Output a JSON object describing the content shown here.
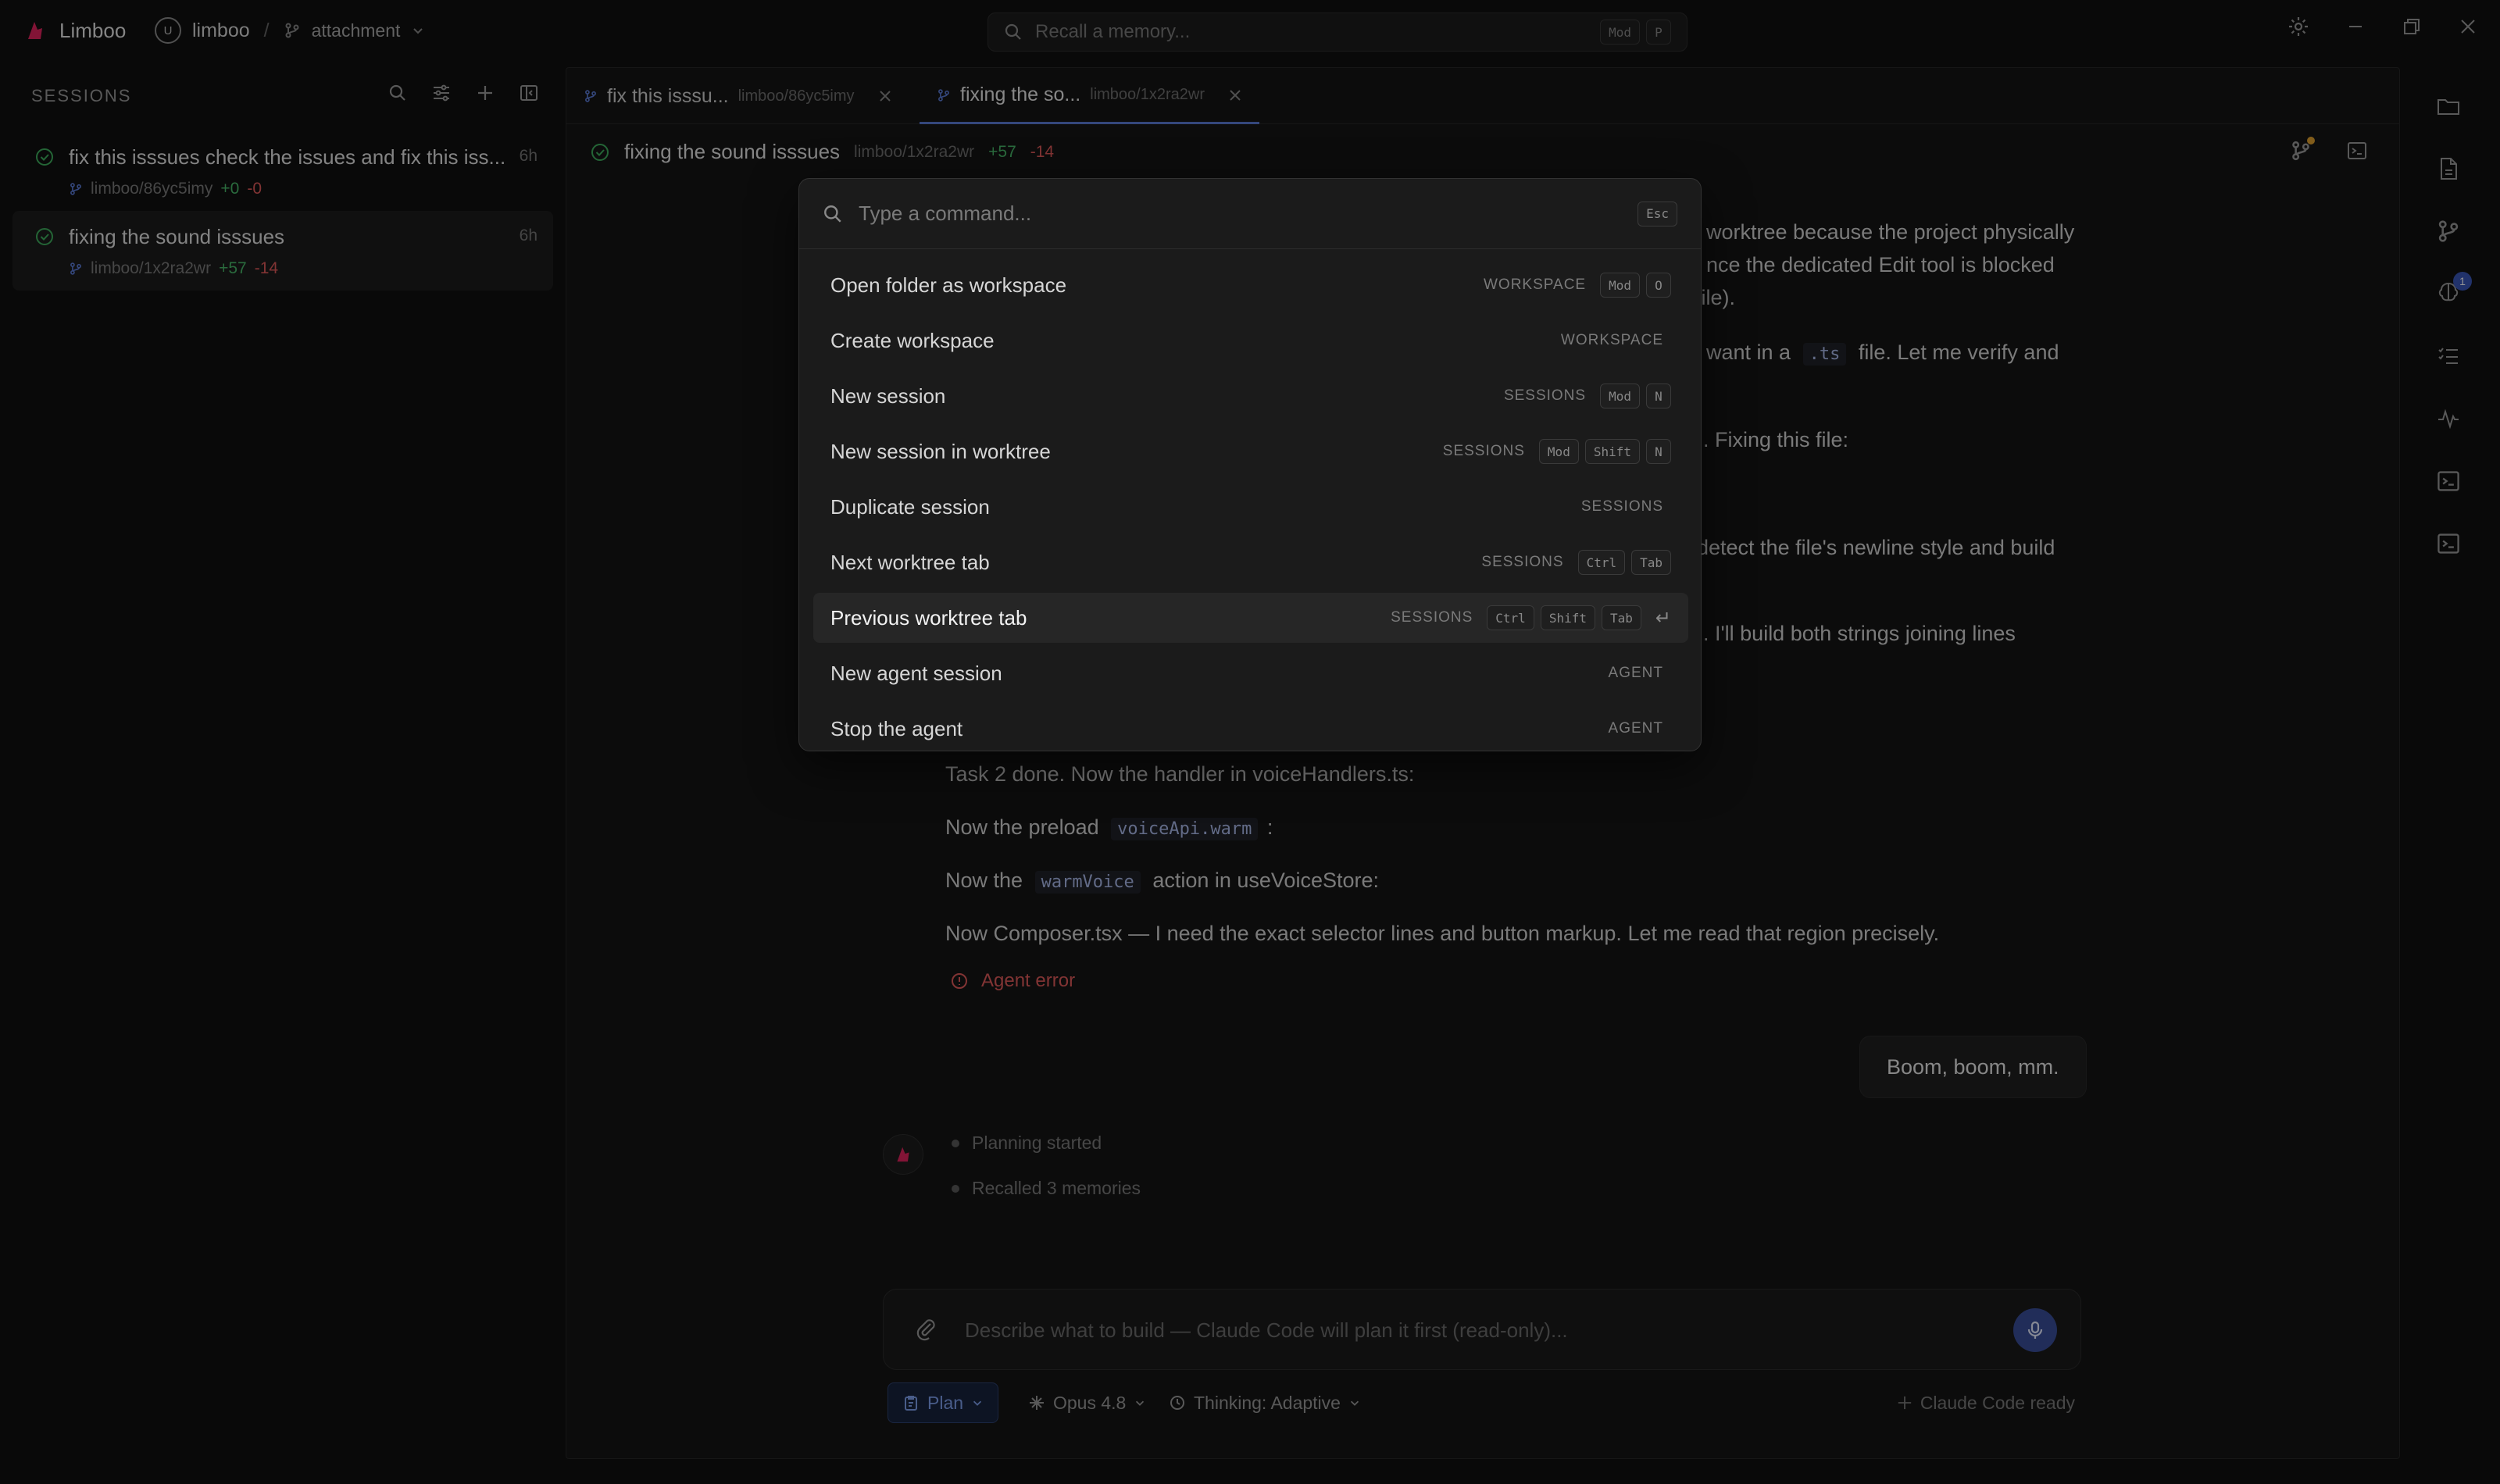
{
  "app": {
    "name": "Limboo",
    "workspace": "limboo",
    "workspace_badge": "U",
    "separator": "/",
    "branch": "attachment"
  },
  "search": {
    "placeholder": "Recall a memory...",
    "keys": [
      "Mod",
      "P"
    ]
  },
  "sidebar": {
    "title": "SESSIONS",
    "sessions": [
      {
        "title": "fix this isssues check the issues and fix this iss...",
        "time": "6h",
        "branch": "limboo/86yc5imy",
        "added": "+0",
        "removed": "-0"
      },
      {
        "title": "fixing the sound isssues",
        "time": "6h",
        "branch": "limboo/1x2ra2wr",
        "added": "+57",
        "removed": "-14"
      }
    ]
  },
  "tabs": [
    {
      "label": "fix this isssu...",
      "path": "limboo/86yc5imy"
    },
    {
      "label": "fixing the so...",
      "path": "limboo/1x2ra2wr"
    }
  ],
  "header": {
    "title": "fixing the sound isssues",
    "path": "limboo/1x2ra2wr",
    "added": "+57",
    "removed": "-14"
  },
  "chat": {
    "partial": {
      "l1": "worktree because the project physically",
      "l2": "nce the dedicated Edit tool is blocked",
      "l3": "file).",
      "l4a": "want in a",
      "l4code": ".ts",
      "l4b": "file. Let me verify and",
      "l5": ". Fixing this file:",
      "l6": "detect the file's newline style and build",
      "l7": ". I'll build both strings joining lines"
    },
    "task2": "Task 2 done. Now the handler in voiceHandlers.ts:",
    "preload_a": "Now the preload",
    "preload_code": "voiceApi.warm",
    "preload_b": ":",
    "warm_a": "Now the",
    "warm_code": "warmVoice",
    "warm_b": "action in useVoiceStore:",
    "composer_line": "Now Composer.tsx — I need the exact selector lines and button markup. Let me read that region precisely.",
    "agent_error": "Agent error",
    "user_message": "Boom, boom, mm.",
    "steps": [
      "Planning started",
      "Recalled 3 memories"
    ]
  },
  "composer": {
    "placeholder": "Describe what to build — Claude Code will plan it first (read-only)...",
    "mode": "Plan",
    "model": "Opus 4.8",
    "thinking": "Thinking: Adaptive",
    "status": "Claude Code ready"
  },
  "activity": {
    "badge": "1"
  },
  "palette": {
    "placeholder": "Type a command...",
    "esc": "Esc",
    "commands": [
      {
        "label": "Open folder as workspace",
        "category": "WORKSPACE",
        "keys": [
          "Mod",
          "O"
        ]
      },
      {
        "label": "Create workspace",
        "category": "WORKSPACE",
        "keys": []
      },
      {
        "label": "New session",
        "category": "SESSIONS",
        "keys": [
          "Mod",
          "N"
        ]
      },
      {
        "label": "New session in worktree",
        "category": "SESSIONS",
        "keys": [
          "Mod",
          "Shift",
          "N"
        ]
      },
      {
        "label": "Duplicate session",
        "category": "SESSIONS",
        "keys": []
      },
      {
        "label": "Next worktree tab",
        "category": "SESSIONS",
        "keys": [
          "Ctrl",
          "Tab"
        ]
      },
      {
        "label": "Previous worktree tab",
        "category": "SESSIONS",
        "keys": [
          "Ctrl",
          "Shift",
          "Tab"
        ],
        "enter": "↵"
      },
      {
        "label": "New agent session",
        "category": "AGENT",
        "keys": []
      },
      {
        "label": "Stop the agent",
        "category": "AGENT",
        "keys": []
      }
    ]
  },
  "colors": {
    "accent": "#5b7bd6",
    "brand": "#e0245e",
    "added": "#49b86a",
    "removed": "#e05a5a",
    "success": "#3fae5e"
  }
}
